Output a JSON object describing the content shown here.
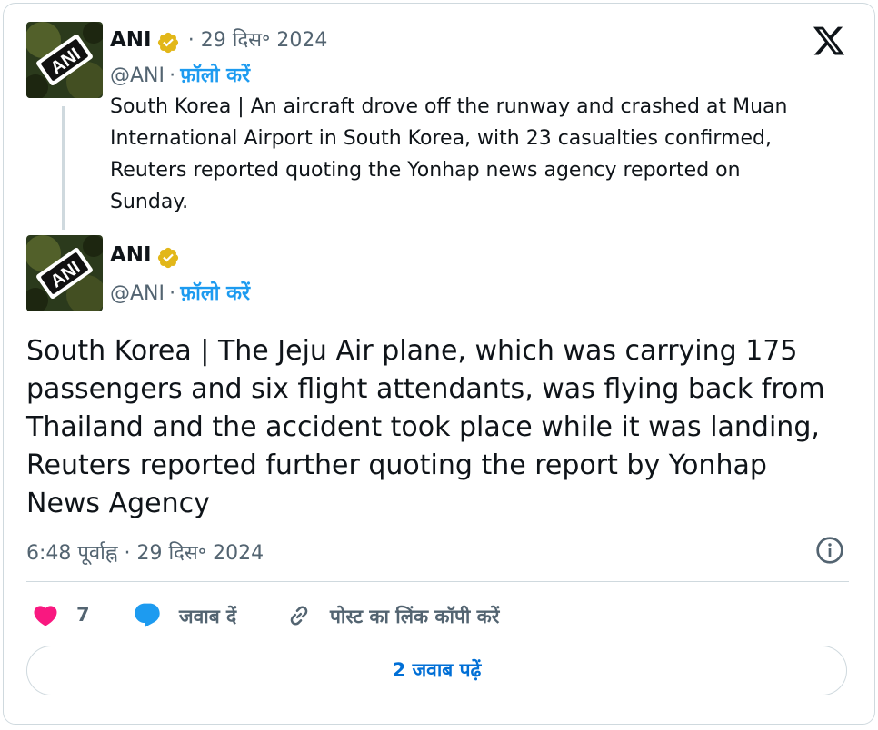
{
  "quoted_tweet": {
    "author_name": "ANI",
    "handle": "@ANI",
    "date": "· 29 दिस॰ 2024",
    "separator": "·",
    "follow_label": "फ़ॉलो करें",
    "avatar_text": "ANI",
    "text_lines": [
      "South Korea | An aircraft drove off the runway and crashed at Muan",
      "International Airport in South Korea, with 23 casualties confirmed,",
      "Reuters reported quoting the Yonhap news agency reported on",
      "Sunday."
    ]
  },
  "main_tweet": {
    "author_name": "ANI",
    "handle": "@ANI",
    "separator": "·",
    "follow_label": "फ़ॉलो करें",
    "avatar_text": "ANI",
    "text_lines": [
      "South Korea | The Jeju Air plane, which was carrying 175",
      "passengers and six flight attendants, was flying back from",
      "Thailand and the accident took place while it was landing,",
      "Reuters reported further quoting the report by Yonhap",
      "News Agency"
    ],
    "timestamp": "6:48 पूर्वाह्न · 29 दिस॰ 2024"
  },
  "actions": {
    "like_count": "7",
    "reply_label": "जवाब दें",
    "copy_link_label": "पोस्ट का लिंक कॉपी करें"
  },
  "read_replies_label": "2 जवाब पढ़ें",
  "icons": {
    "brand": "x-logo-icon",
    "verified": "verified-badge-icon",
    "info": "info-icon",
    "like": "heart-icon",
    "reply": "reply-bubble-icon",
    "link": "link-icon"
  },
  "colors": {
    "like": "#f91880",
    "reply": "#1d9bf0",
    "follow": "#1d9bf0",
    "verified": "#e2b719",
    "read_replies": "#006fd6"
  }
}
